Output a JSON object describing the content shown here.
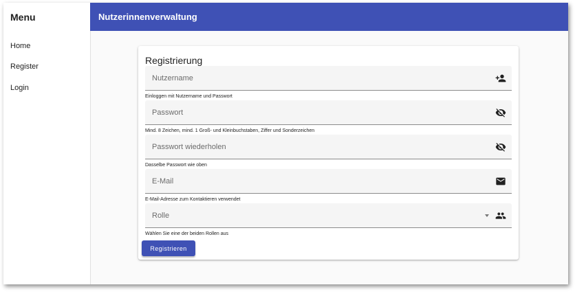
{
  "sidebar": {
    "title": "Menu",
    "items": [
      {
        "label": "Home"
      },
      {
        "label": "Register"
      },
      {
        "label": "Login"
      }
    ]
  },
  "toolbar": {
    "title": "Nutzerinnenverwaltung",
    "color": "#3f51b5"
  },
  "form": {
    "title": "Registrierung",
    "fields": [
      {
        "placeholder": "Nutzername",
        "hint": "Einloggen mit Nutzername und Passwort",
        "icon": "person-add-icon"
      },
      {
        "placeholder": "Passwort",
        "hint": "Mind. 8 Zeichen, mind. 1 Groß- und Kleinbuchstaben, Ziffer und Sonderzeichen",
        "icon": "visibility-off-icon"
      },
      {
        "placeholder": "Passwort wiederholen",
        "hint": "Dasselbe Passwort wie oben",
        "icon": "visibility-off-icon"
      },
      {
        "placeholder": "E-Mail",
        "hint": "E-Mail-Adresse zum Kontaktieren verwendet",
        "icon": "mail-icon"
      },
      {
        "placeholder": "Rolle",
        "hint": "Wählen Sie eine der beiden Rollen aus",
        "icon": "group-icon"
      }
    ],
    "submit_label": "Registrieren"
  }
}
